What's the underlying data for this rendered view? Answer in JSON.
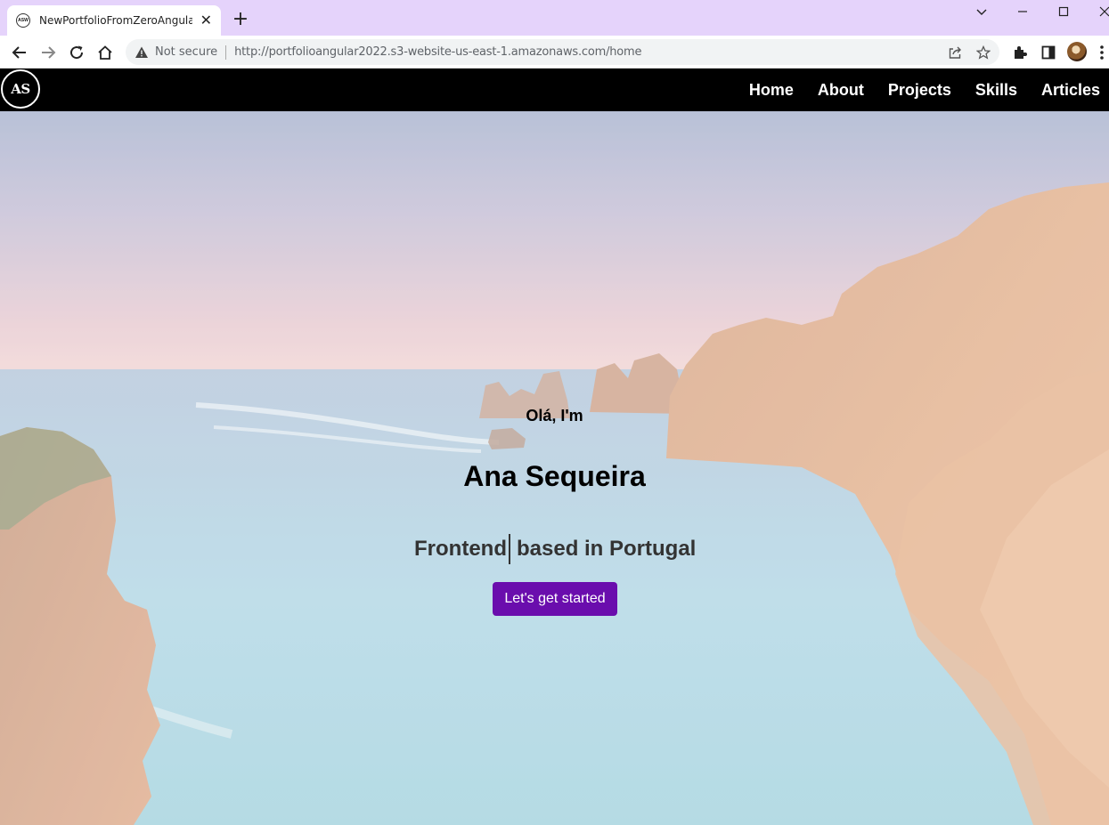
{
  "browser": {
    "tab_title": "NewPortfolioFromZeroAngular",
    "favicon_text": "ASW",
    "security_label": "Not secure",
    "url_scheme": "http://",
    "url_host": "portfolioangular2022.s3-website-us-east-1.amazonaws.com",
    "url_path": "/home"
  },
  "site": {
    "logo_text": "AS",
    "nav": [
      {
        "label": "Home"
      },
      {
        "label": "About"
      },
      {
        "label": "Projects"
      },
      {
        "label": "Skills"
      },
      {
        "label": "Articles"
      }
    ]
  },
  "hero": {
    "greeting": "Olá, I'm",
    "name": "Ana Sequeira",
    "role": "Frontend",
    "location": "based in Portugal",
    "cta_label": "Let's get started"
  },
  "colors": {
    "accent": "#6a0dad",
    "header_bg": "#000000",
    "tabstrip_bg": "#e5d3fb"
  },
  "icons": [
    "tab-favicon-icon",
    "close-icon",
    "plus-icon",
    "chevron-down-icon",
    "minimize-icon",
    "maximize-icon",
    "close-window-icon",
    "back-icon",
    "forward-icon",
    "reload-icon",
    "home-icon",
    "warning-icon",
    "share-icon",
    "star-icon",
    "extensions-icon",
    "side-panel-icon",
    "menu-icon"
  ]
}
